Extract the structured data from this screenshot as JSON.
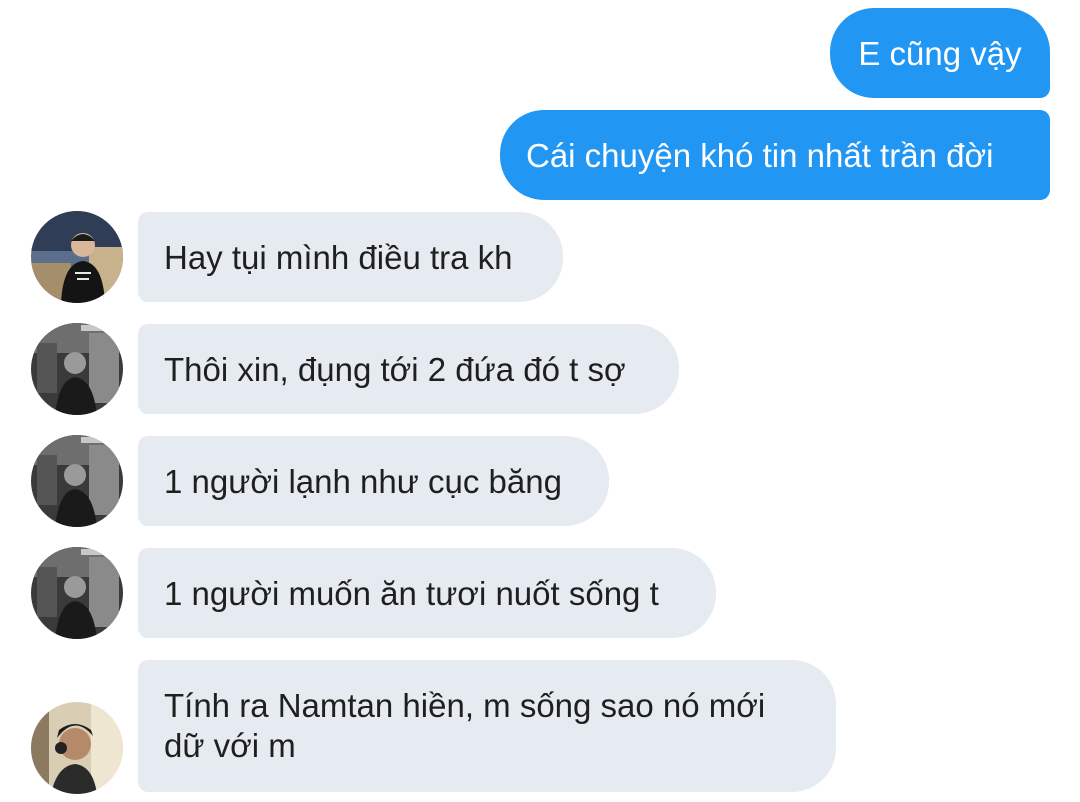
{
  "messages": {
    "out_1": "E cũng vậy",
    "out_2": "Cái chuyện khó tin nhất trần đời",
    "in_1": "Hay tụi mình điều tra kh",
    "in_2": "Thôi xin, đụng tới 2 đứa đó t sợ",
    "in_3": "1 người lạnh như cục băng",
    "in_4": "1 người muốn ăn tươi nuốt sống t",
    "in_5_line1": "Tính ra Namtan hiền, m sống sao nó mới",
    "in_5_line2": "dữ với m"
  },
  "colors": {
    "outgoing_bubble": "#2196f3",
    "incoming_bubble": "#e6ebf1",
    "background": "#ffffff"
  }
}
